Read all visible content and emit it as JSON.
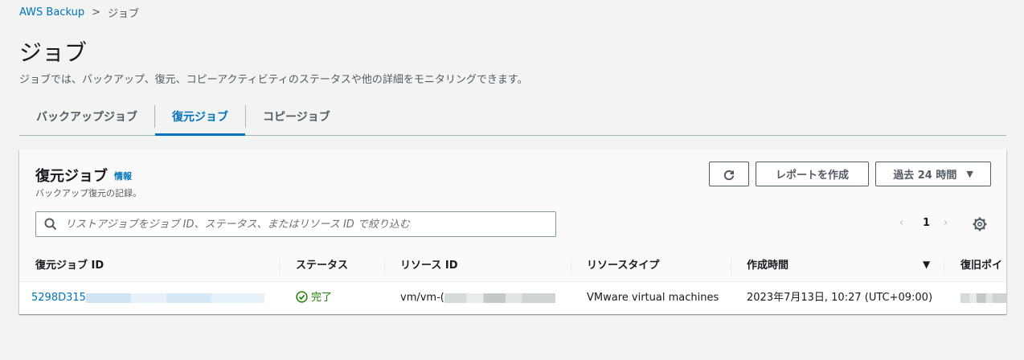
{
  "breadcrumb": {
    "root": "AWS Backup",
    "current": "ジョブ"
  },
  "page": {
    "title": "ジョブ",
    "description": "ジョブでは、バックアップ、復元、コピーアクティビティのステータスや他の詳細をモニタリングできます。"
  },
  "tabs": [
    {
      "label": "バックアップジョブ",
      "active": false
    },
    {
      "label": "復元ジョブ",
      "active": true
    },
    {
      "label": "コピージョブ",
      "active": false
    }
  ],
  "panel": {
    "title": "復元ジョブ",
    "info": "情報",
    "description": "バックアップ復元の記録。",
    "refresh_icon": "refresh-icon",
    "report_button": "レポートを作成",
    "range_button": "過去 24 時間",
    "search_placeholder": "リストアジョブをジョブ ID、ステータス、またはリソース ID で絞り込む",
    "page_number": "1",
    "prev": "‹",
    "next": "›"
  },
  "table": {
    "columns": [
      "復元ジョブ ID",
      "ステータス",
      "リソース ID",
      "リソースタイプ",
      "作成時間",
      "復旧ポイ"
    ],
    "rows": [
      {
        "job_id": "5298D315",
        "status": "完了",
        "resource_id": "vm/vm-(",
        "resource_type": "VMware virtual machines",
        "created": "2023年7月13日, 10:27 (UTC+09:00)",
        "recovery_point": ""
      }
    ]
  },
  "colors": {
    "accent": "#0073bb",
    "success": "#1d8102",
    "text": "#16191f",
    "muted": "#545b64"
  }
}
